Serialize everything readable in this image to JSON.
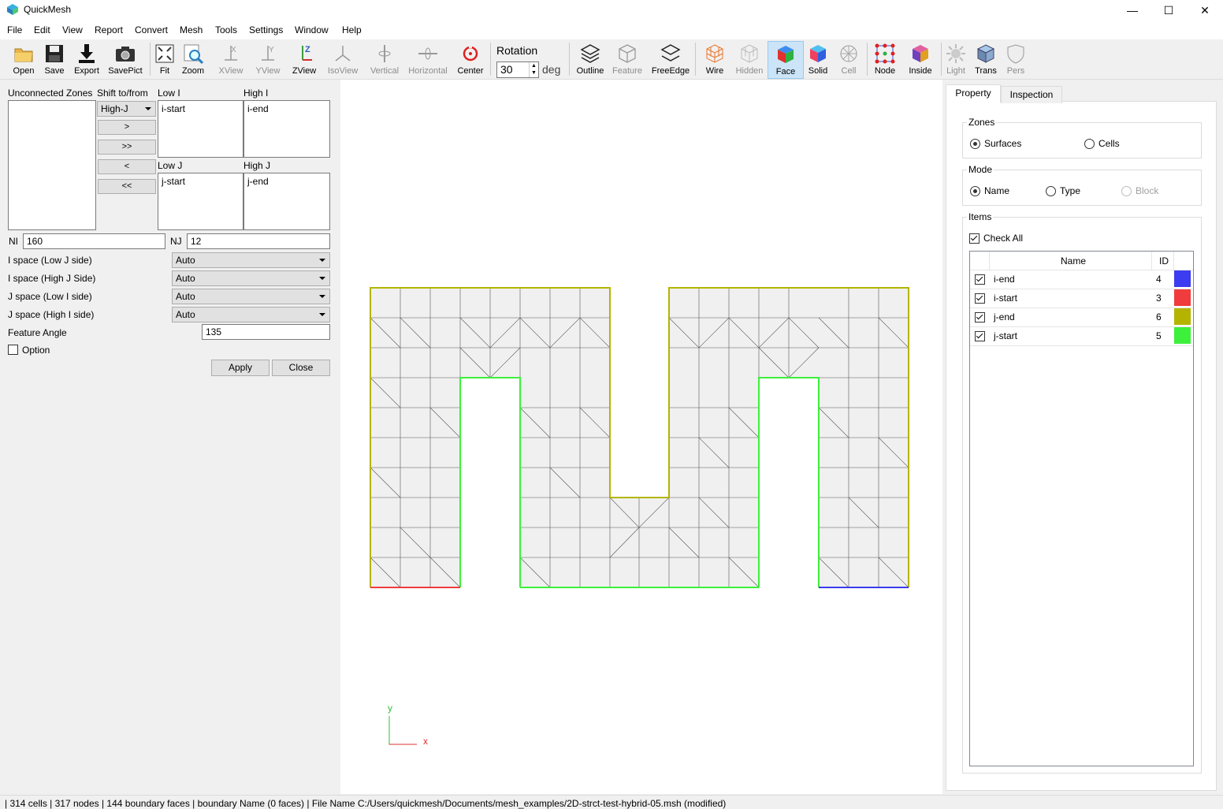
{
  "app": {
    "title": "QuickMesh"
  },
  "menu": [
    "File",
    "Edit",
    "View",
    "Report",
    "Convert",
    "Mesh",
    "Tools",
    "Settings",
    "Window",
    "Help"
  ],
  "toolbar": {
    "open": "Open",
    "save": "Save",
    "export": "Export",
    "savepict": "SavePict",
    "fit": "Fit",
    "zoom": "Zoom",
    "xview": "XView",
    "yview": "YView",
    "zview": "ZView",
    "isoview": "IsoView",
    "vertical": "Vertical",
    "horizontal": "Horizontal",
    "center": "Center",
    "rotation_label": "Rotation",
    "rotation_value": "30",
    "rotation_unit": "deg",
    "outline": "Outline",
    "feature": "Feature",
    "freeedge": "FreeEdge",
    "wire": "Wire",
    "hidden": "Hidden",
    "face": "Face",
    "solid": "Solid",
    "cell": "Cell",
    "node": "Node",
    "inside": "Inside",
    "light": "Light",
    "trans": "Trans",
    "pers": "Pers"
  },
  "left": {
    "unconnected_label": "Unconnected Zones",
    "shift_label": "Shift to/from",
    "shift_select": "High-J",
    "btn_add": ">",
    "btn_add_all": ">>",
    "btn_remove": "<",
    "btn_remove_all": "<<",
    "low_i_label": "Low I",
    "low_i_item": "i-start",
    "high_i_label": "High I",
    "high_i_item": "i-end",
    "low_j_label": "Low J",
    "low_j_item": "j-start",
    "high_j_label": "High J",
    "high_j_item": "j-end",
    "ni_label": "NI",
    "ni_value": "160",
    "nj_label": "NJ",
    "nj_value": "12",
    "ispace_low_label": "I space (Low J side)",
    "ispace_low_value": "Auto",
    "ispace_high_label": "I space (High J Side)",
    "ispace_high_value": "Auto",
    "jspace_low_label": "J space (Low I side)",
    "jspace_low_value": "Auto",
    "jspace_high_label": "J space (High I side)",
    "jspace_high_value": "Auto",
    "feature_angle_label": "Feature Angle",
    "feature_angle_value": "135",
    "option_label": "Option",
    "apply": "Apply",
    "close": "Close"
  },
  "viewport": {
    "axis_y": "y",
    "axis_x": "x"
  },
  "right": {
    "tab_property": "Property",
    "tab_inspection": "Inspection",
    "zones_title": "Zones",
    "zones_surfaces": "Surfaces",
    "zones_cells": "Cells",
    "mode_title": "Mode",
    "mode_name": "Name",
    "mode_type": "Type",
    "mode_block": "Block",
    "items_title": "Items",
    "check_all": "Check All",
    "col_name": "Name",
    "col_id": "ID",
    "rows": [
      {
        "name": "i-end",
        "id": "4",
        "color": "#3c3cf0"
      },
      {
        "name": "i-start",
        "id": "3",
        "color": "#f03c3c"
      },
      {
        "name": "j-end",
        "id": "6",
        "color": "#b4b400"
      },
      {
        "name": "j-start",
        "id": "5",
        "color": "#3cf03c"
      }
    ]
  },
  "status": "| 314 cells | 317 nodes | 144 boundary faces |  boundary Name  (0 faces) | File Name C:/Users/quickmesh/Documents/mesh_examples/2D-strct-test-hybrid-05.msh (modified)"
}
